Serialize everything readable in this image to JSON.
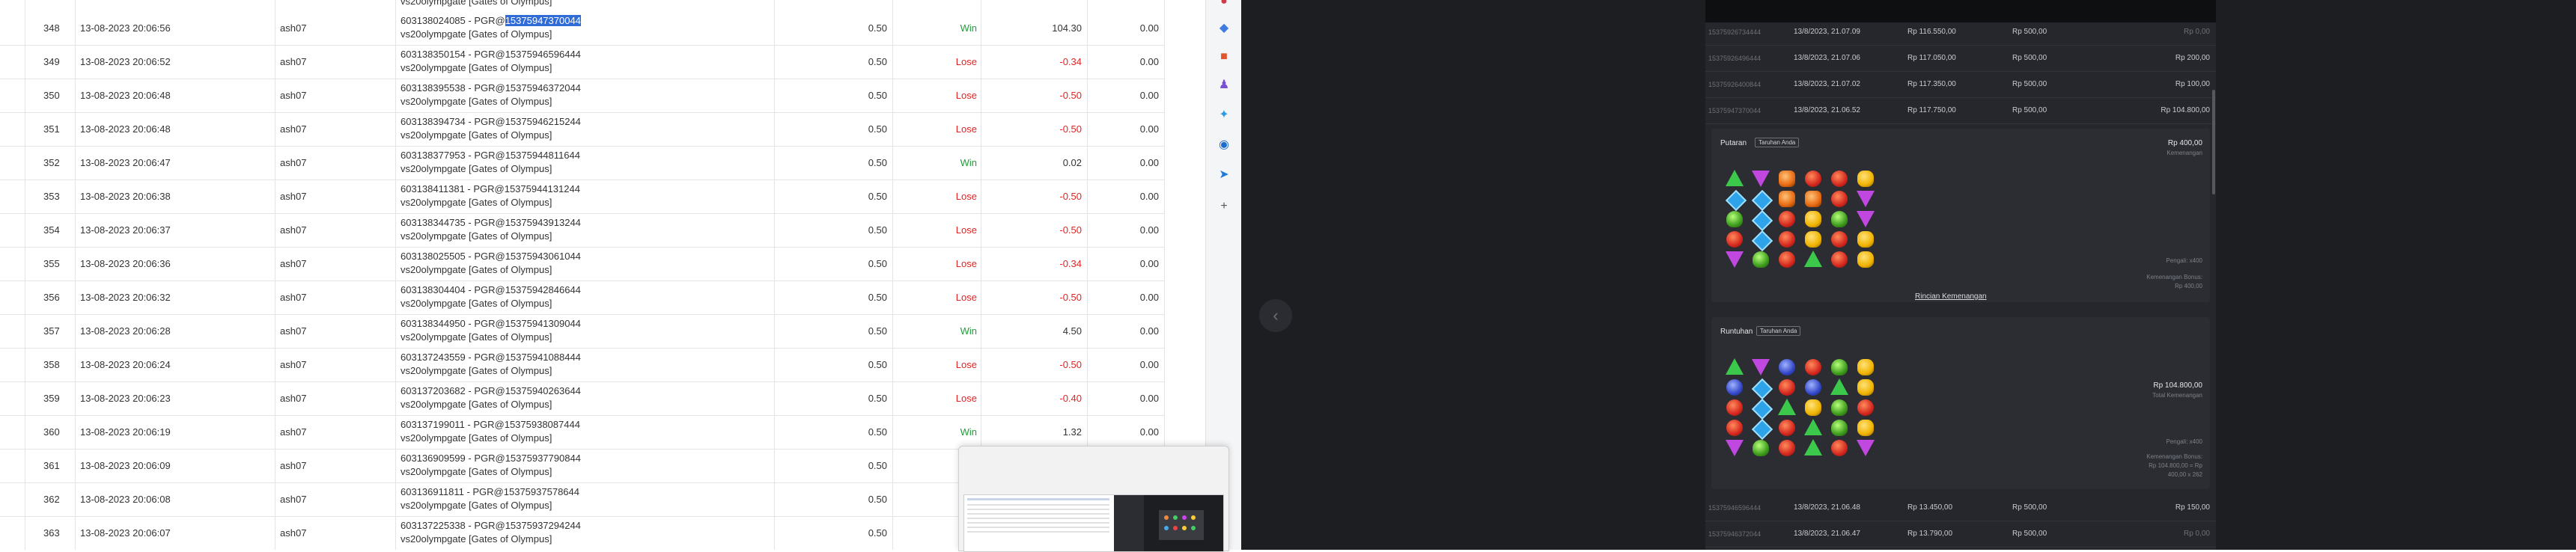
{
  "bet_history": {
    "top_partial_text": "vs20olympgate [Gates of Olympus]",
    "highlighted_fragment": "15375947370044",
    "rows": [
      {
        "no": "348",
        "date": "13-08-2023 20:06:56",
        "user": "ash07",
        "desc_prefix": "603138024085 - PGR@",
        "desc_id": "15375947370044",
        "desc_game": "vs20olympgate [Gates of Olympus]",
        "stake": "0.50",
        "result": "Win",
        "pl": "104.30",
        "extra": "0.00",
        "highlight": true
      },
      {
        "no": "349",
        "date": "13-08-2023 20:06:52",
        "user": "ash07",
        "desc_prefix": "603138350154 - PGR@",
        "desc_id": "15375946596444",
        "desc_game": "vs20olympgate [Gates of Olympus]",
        "stake": "0.50",
        "result": "Lose",
        "pl": "-0.34",
        "extra": "0.00"
      },
      {
        "no": "350",
        "date": "13-08-2023 20:06:48",
        "user": "ash07",
        "desc_prefix": "603138395538 - PGR@",
        "desc_id": "15375946372044",
        "desc_game": "vs20olympgate [Gates of Olympus]",
        "stake": "0.50",
        "result": "Lose",
        "pl": "-0.50",
        "extra": "0.00"
      },
      {
        "no": "351",
        "date": "13-08-2023 20:06:48",
        "user": "ash07",
        "desc_prefix": "603138394734 - PGR@",
        "desc_id": "15375946215244",
        "desc_game": "vs20olympgate [Gates of Olympus]",
        "stake": "0.50",
        "result": "Lose",
        "pl": "-0.50",
        "extra": "0.00"
      },
      {
        "no": "352",
        "date": "13-08-2023 20:06:47",
        "user": "ash07",
        "desc_prefix": "603138377953 - PGR@",
        "desc_id": "15375944811644",
        "desc_game": "vs20olympgate [Gates of Olympus]",
        "stake": "0.50",
        "result": "Win",
        "pl": "0.02",
        "extra": "0.00"
      },
      {
        "no": "353",
        "date": "13-08-2023 20:06:38",
        "user": "ash07",
        "desc_prefix": "603138411381 - PGR@",
        "desc_id": "15375944131244",
        "desc_game": "vs20olympgate [Gates of Olympus]",
        "stake": "0.50",
        "result": "Lose",
        "pl": "-0.50",
        "extra": "0.00"
      },
      {
        "no": "354",
        "date": "13-08-2023 20:06:37",
        "user": "ash07",
        "desc_prefix": "603138344735 - PGR@",
        "desc_id": "15375943913244",
        "desc_game": "vs20olympgate [Gates of Olympus]",
        "stake": "0.50",
        "result": "Lose",
        "pl": "-0.50",
        "extra": "0.00"
      },
      {
        "no": "355",
        "date": "13-08-2023 20:06:36",
        "user": "ash07",
        "desc_prefix": "603138025505 - PGR@",
        "desc_id": "15375943061044",
        "desc_game": "vs20olympgate [Gates of Olympus]",
        "stake": "0.50",
        "result": "Lose",
        "pl": "-0.34",
        "extra": "0.00"
      },
      {
        "no": "356",
        "date": "13-08-2023 20:06:32",
        "user": "ash07",
        "desc_prefix": "603138304404 - PGR@",
        "desc_id": "15375942846644",
        "desc_game": "vs20olympgate [Gates of Olympus]",
        "stake": "0.50",
        "result": "Lose",
        "pl": "-0.50",
        "extra": "0.00"
      },
      {
        "no": "357",
        "date": "13-08-2023 20:06:28",
        "user": "ash07",
        "desc_prefix": "603138344950 - PGR@",
        "desc_id": "15375941309044",
        "desc_game": "vs20olympgate [Gates of Olympus]",
        "stake": "0.50",
        "result": "Win",
        "pl": "4.50",
        "extra": "0.00"
      },
      {
        "no": "358",
        "date": "13-08-2023 20:06:24",
        "user": "ash07",
        "desc_prefix": "603137243559 - PGR@",
        "desc_id": "15375941088444",
        "desc_game": "vs20olympgate [Gates of Olympus]",
        "stake": "0.50",
        "result": "Lose",
        "pl": "-0.50",
        "extra": "0.00"
      },
      {
        "no": "359",
        "date": "13-08-2023 20:06:23",
        "user": "ash07",
        "desc_prefix": "603137203682 - PGR@",
        "desc_id": "15375940263644",
        "desc_game": "vs20olympgate [Gates of Olympus]",
        "stake": "0.50",
        "result": "Lose",
        "pl": "-0.40",
        "extra": "0.00"
      },
      {
        "no": "360",
        "date": "13-08-2023 20:06:19",
        "user": "ash07",
        "desc_prefix": "603137199011 - PGR@",
        "desc_id": "15375938087444",
        "desc_game": "vs20olympgate [Gates of Olympus]",
        "stake": "0.50",
        "result": "Win",
        "pl": "1.32",
        "extra": "0.00"
      },
      {
        "no": "361",
        "date": "13-08-2023 20:06:09",
        "user": "ash07",
        "desc_prefix": "603136909599 - PGR@",
        "desc_id": "15375937790844",
        "desc_game": "vs20olympgate [Gates of Olympus]",
        "stake": "0.50",
        "result": "",
        "pl": "",
        "extra": "0.00"
      },
      {
        "no": "362",
        "date": "13-08-2023 20:06:08",
        "user": "ash07",
        "desc_prefix": "603136911811 - PGR@",
        "desc_id": "15375937578644",
        "desc_game": "vs20olympgate [Gates of Olympus]",
        "stake": "0.50",
        "result": "",
        "pl": "",
        "extra": "0.00"
      },
      {
        "no": "363",
        "date": "13-08-2023 20:06:07",
        "user": "ash07",
        "desc_prefix": "603137225338 - PGR@",
        "desc_id": "15375937294244",
        "desc_game": "vs20olympgate [Gates of Olympus]",
        "stake": "0.50",
        "result": "",
        "pl": "",
        "extra": "0.00"
      }
    ]
  },
  "sidebar_icons": [
    "tag-icon",
    "briefcase-icon",
    "user-icon",
    "copilot-icon",
    "outlook-icon",
    "plane-icon",
    "add-icon"
  ],
  "colors": {
    "win": "#1e9e3a",
    "lose": "#e02424",
    "highlight": "#2f6cd8",
    "dark_bg": "#1c1e22"
  },
  "game_history": {
    "top_rows": [
      {
        "id": "15375926734444",
        "datetime": "13/8/2023, 21.07.09",
        "balance": "Rp 116.550,00",
        "bet": "Rp 500,00",
        "win": "Rp 0,00",
        "win_dim": true
      },
      {
        "id": "15375926496444",
        "datetime": "13/8/2023, 21.07.06",
        "balance": "Rp 117.050,00",
        "bet": "Rp 500,00",
        "win": "Rp 200,00",
        "win_dim": false
      },
      {
        "id": "15375926400844",
        "datetime": "13/8/2023, 21.07.02",
        "balance": "Rp 117.350,00",
        "bet": "Rp 500,00",
        "win": "Rp 100,00",
        "win_dim": false
      },
      {
        "id": "15375947370044",
        "datetime": "13/8/2023, 21.06.52",
        "balance": "Rp 117.750,00",
        "bet": "Rp 500,00",
        "win": "Rp 104.800,00",
        "win_dim": false
      }
    ],
    "spin_section": {
      "title": "Putaran",
      "badge": "Taruhan Anda",
      "win_value": "Rp 400,00",
      "win_label": "Kemenangan",
      "sub1": "Pengali: x400",
      "sub2": "Kemenangan Bonus:",
      "sub3": "Rp 400,00",
      "link": "Rincian Kemenangan"
    },
    "bonus_section": {
      "title": "Runtuhan",
      "badge": "Taruhan Anda",
      "win_value": "Rp 104.800,00",
      "win_label": "Total Kemenangan",
      "sub1": "Pengali: x400",
      "sub2": "Kemenangan Bonus:",
      "sub3": "Rp 104.800,00 = Rp",
      "sub4": "400,00 x 262"
    },
    "bottom_rows": [
      {
        "id": "15375946596444",
        "datetime": "13/8/2023, 21.06.48",
        "balance": "Rp 13.450,00",
        "bet": "Rp 500,00",
        "win": "Rp 150,00",
        "win_dim": false
      },
      {
        "id": "15375946372044",
        "datetime": "13/8/2023, 21.06.47",
        "balance": "Rp 13.790,00",
        "bet": "Rp 500,00",
        "win": "Rp 0,00",
        "win_dim": true
      }
    ]
  }
}
